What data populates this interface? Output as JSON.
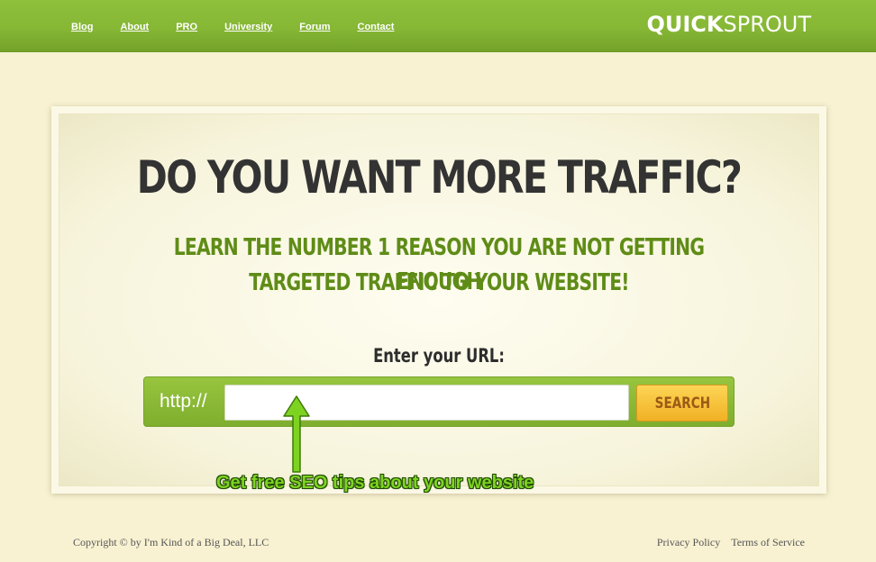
{
  "header": {
    "nav": [
      {
        "label": "Blog"
      },
      {
        "label": "About"
      },
      {
        "label": "PRO"
      },
      {
        "label": "University"
      },
      {
        "label": "Forum"
      },
      {
        "label": "Contact"
      }
    ],
    "logo_bold": "QUICK",
    "logo_light": "SPROUT"
  },
  "main": {
    "headline": "DO YOU WANT MORE TRAFFIC?",
    "sub_line1": "LEARN THE NUMBER 1 REASON YOU ARE NOT GETTING ENOUGH",
    "sub_line2": "TARGETED TRAFFIC TO YOUR WEBSITE!",
    "url_label": "Enter your URL:",
    "url_prefix": "http://",
    "url_value": "",
    "search_label": "SEARCH",
    "tip": "Get free SEO tips about your website"
  },
  "footer": {
    "copyright": "Copyright © by I'm Kind of a Big Deal, LLC",
    "privacy": "Privacy Policy",
    "terms": "Terms of Service"
  },
  "colors": {
    "header_green": "#86b735",
    "page_bg": "#f8f2d2",
    "subheading_green": "#5f8c17",
    "search_button": "#f6c23b",
    "arrow_green": "#7ed321"
  }
}
